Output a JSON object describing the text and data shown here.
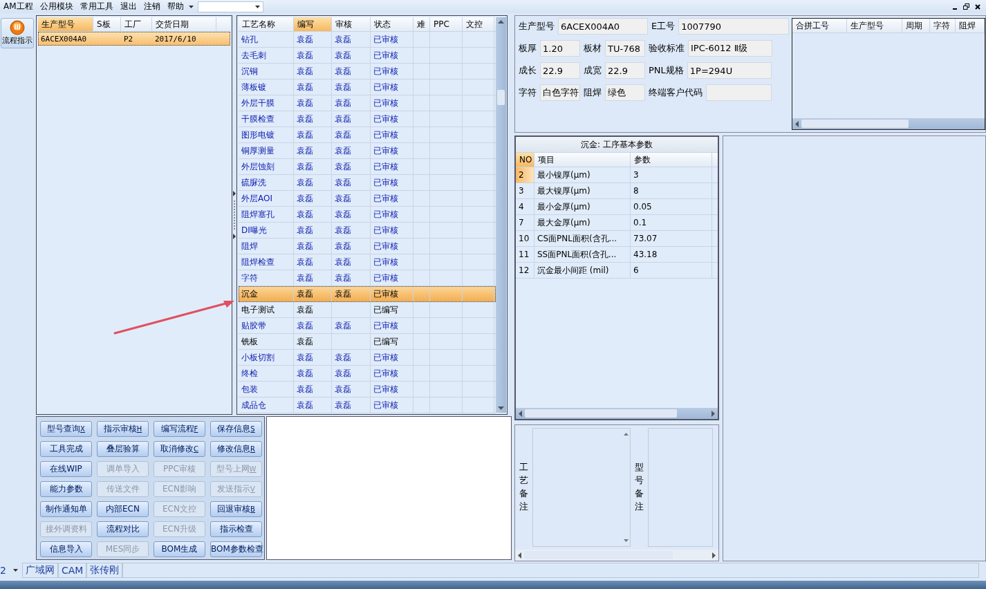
{
  "menu": {
    "items": [
      "AM工程",
      "公用模块",
      "常用工具",
      "退出",
      "注销",
      "帮助"
    ]
  },
  "side_button": {
    "label": "流程指示"
  },
  "orders": {
    "columns": [
      "生产型号",
      "S板",
      "工厂",
      "交货日期"
    ],
    "rows": [
      {
        "cells": [
          "6ACEX004A0",
          "",
          "P2",
          "2017/6/10"
        ],
        "selected": true
      }
    ]
  },
  "processes": {
    "columns": [
      {
        "label": "工艺名称",
        "selected": false
      },
      {
        "label": "编写",
        "selected": true
      },
      {
        "label": "审核",
        "selected": false
      },
      {
        "label": "状态",
        "selected": false
      },
      {
        "label": "难",
        "selected": false
      },
      {
        "label": "PPC",
        "selected": false
      },
      {
        "label": "文控",
        "selected": false
      }
    ],
    "rows": [
      {
        "name": "钻孔",
        "writer": "袁磊",
        "reviewer": "袁磊",
        "status": "已审核",
        "approved": true,
        "selected": false
      },
      {
        "name": "去毛刺",
        "writer": "袁磊",
        "reviewer": "袁磊",
        "status": "已审核",
        "approved": true,
        "selected": false
      },
      {
        "name": "沉铜",
        "writer": "袁磊",
        "reviewer": "袁磊",
        "status": "已审核",
        "approved": true,
        "selected": false
      },
      {
        "name": "薄板镀",
        "writer": "袁磊",
        "reviewer": "袁磊",
        "status": "已审核",
        "approved": true,
        "selected": false
      },
      {
        "name": "外层干膜",
        "writer": "袁磊",
        "reviewer": "袁磊",
        "status": "已审核",
        "approved": true,
        "selected": false
      },
      {
        "name": "干膜检查",
        "writer": "袁磊",
        "reviewer": "袁磊",
        "status": "已审核",
        "approved": true,
        "selected": false
      },
      {
        "name": "图形电镀",
        "writer": "袁磊",
        "reviewer": "袁磊",
        "status": "已审核",
        "approved": true,
        "selected": false
      },
      {
        "name": "铜厚测量",
        "writer": "袁磊",
        "reviewer": "袁磊",
        "status": "已审核",
        "approved": true,
        "selected": false
      },
      {
        "name": "外层蚀刻",
        "writer": "袁磊",
        "reviewer": "袁磊",
        "status": "已审核",
        "approved": true,
        "selected": false
      },
      {
        "name": "硫脲洗",
        "writer": "袁磊",
        "reviewer": "袁磊",
        "status": "已审核",
        "approved": true,
        "selected": false
      },
      {
        "name": "外层AOI",
        "writer": "袁磊",
        "reviewer": "袁磊",
        "status": "已审核",
        "approved": true,
        "selected": false
      },
      {
        "name": "阻焊塞孔",
        "writer": "袁磊",
        "reviewer": "袁磊",
        "status": "已审核",
        "approved": true,
        "selected": false
      },
      {
        "name": "DI曝光",
        "writer": "袁磊",
        "reviewer": "袁磊",
        "status": "已审核",
        "approved": true,
        "selected": false
      },
      {
        "name": "阻焊",
        "writer": "袁磊",
        "reviewer": "袁磊",
        "status": "已审核",
        "approved": true,
        "selected": false
      },
      {
        "name": "阻焊检查",
        "writer": "袁磊",
        "reviewer": "袁磊",
        "status": "已审核",
        "approved": true,
        "selected": false
      },
      {
        "name": "字符",
        "writer": "袁磊",
        "reviewer": "袁磊",
        "status": "已审核",
        "approved": true,
        "selected": false
      },
      {
        "name": "沉金",
        "writer": "袁磊",
        "reviewer": "袁磊",
        "status": "已审核",
        "approved": true,
        "selected": true
      },
      {
        "name": "电子测试",
        "writer": "袁磊",
        "reviewer": "",
        "status": "已编写",
        "approved": false,
        "selected": false
      },
      {
        "name": "贴胶带",
        "writer": "袁磊",
        "reviewer": "袁磊",
        "status": "已审核",
        "approved": true,
        "selected": false
      },
      {
        "name": "铣板",
        "writer": "袁磊",
        "reviewer": "",
        "status": "已编写",
        "approved": false,
        "selected": false
      },
      {
        "name": "小板切割",
        "writer": "袁磊",
        "reviewer": "袁磊",
        "status": "已审核",
        "approved": true,
        "selected": false
      },
      {
        "name": "终检",
        "writer": "袁磊",
        "reviewer": "袁磊",
        "status": "已审核",
        "approved": true,
        "selected": false
      },
      {
        "name": "包装",
        "writer": "袁磊",
        "reviewer": "袁磊",
        "status": "已审核",
        "approved": true,
        "selected": false
      },
      {
        "name": "成品仓",
        "writer": "袁磊",
        "reviewer": "袁磊",
        "status": "已审核",
        "approved": true,
        "selected": false
      }
    ]
  },
  "buttons": [
    {
      "label": "型号查询",
      "key": "X",
      "disabled": false
    },
    {
      "label": "指示审核",
      "key": "H",
      "disabled": false
    },
    {
      "label": "编写流程",
      "key": "F",
      "disabled": false
    },
    {
      "label": "保存信息",
      "key": "S",
      "disabled": false
    },
    {
      "label": "工具完成",
      "disabled": false
    },
    {
      "label": "叠层验算",
      "disabled": false
    },
    {
      "label": "取消修改",
      "key": "C",
      "disabled": false
    },
    {
      "label": "修改信息",
      "key": "R",
      "disabled": false
    },
    {
      "label": "在线WIP",
      "disabled": false
    },
    {
      "label": "调单导入",
      "disabled": true
    },
    {
      "label": "PPC审核",
      "disabled": true
    },
    {
      "label": "型号上网",
      "key": "W",
      "disabled": true
    },
    {
      "label": "能力参数",
      "disabled": false
    },
    {
      "label": "传送文件",
      "disabled": true
    },
    {
      "label": "ECN影响",
      "disabled": true
    },
    {
      "label": "发送指示",
      "key": "V",
      "disabled": true
    },
    {
      "label": "制作通知单",
      "disabled": false
    },
    {
      "label": "内部ECN",
      "disabled": false
    },
    {
      "label": "ECN文控",
      "disabled": true
    },
    {
      "label": "回退审核",
      "key": "B",
      "disabled": false
    },
    {
      "label": "接外调资料",
      "disabled": true
    },
    {
      "label": "流程对比",
      "disabled": false
    },
    {
      "label": "ECN升级",
      "disabled": true
    },
    {
      "label": "指示检查",
      "disabled": false
    },
    {
      "label": "信息导入",
      "disabled": false
    },
    {
      "label": "MES同步",
      "disabled": true
    },
    {
      "label": "BOM生成",
      "disabled": false
    },
    {
      "label": "BOM参数检查",
      "disabled": false
    }
  ],
  "info": [
    [
      {
        "label": "生产型号",
        "value": "6ACEX004A0"
      },
      {
        "label": "E工号",
        "value": "1007790"
      }
    ],
    [
      {
        "label": "板厚",
        "value": "1.20"
      },
      {
        "label": "板材",
        "value": "TU-768"
      },
      {
        "label": "验收标准",
        "value": "IPC-6012 Ⅱ级"
      }
    ],
    [
      {
        "label": "成长",
        "value": "22.9"
      },
      {
        "label": "成宽",
        "value": "22.9"
      },
      {
        "label": "PNL规格",
        "value": "1P=294U"
      }
    ],
    [
      {
        "label": "字符",
        "value": "白色字符"
      },
      {
        "label": "阻焊",
        "value": "绿色"
      },
      {
        "label": "终端客户代码"
      }
    ]
  ],
  "combine": {
    "columns": [
      "合拼工号",
      "生产型号",
      "周期",
      "字符",
      "阻焊"
    ]
  },
  "params": {
    "title": "沉金: 工序基本参数",
    "columns": [
      "NO",
      "项目",
      "参数"
    ],
    "rows": [
      {
        "no": "2",
        "item": "最小镍厚(μm)",
        "value": "3",
        "selected": true
      },
      {
        "no": "3",
        "item": "最大镍厚(μm)",
        "value": "8",
        "selected": false
      },
      {
        "no": "4",
        "item": "最小金厚(μm)",
        "value": "0.05",
        "selected": false
      },
      {
        "no": "7",
        "item": "最大金厚(μm)",
        "value": "0.1",
        "selected": false
      },
      {
        "no": "10",
        "item": "CS面PNL面积(含孔...",
        "value": "73.07",
        "selected": false
      },
      {
        "no": "11",
        "item": "SS面PNL面积(含孔...",
        "value": "43.18",
        "selected": false
      },
      {
        "no": "12",
        "item": "沉金最小间距 (mil)",
        "value": "6",
        "selected": false
      }
    ]
  },
  "remarks": [
    {
      "label": "工艺备注"
    },
    {
      "label": "型号备注"
    }
  ],
  "status_bar": [
    "2",
    "广域网",
    "CAM",
    "张传刚"
  ]
}
